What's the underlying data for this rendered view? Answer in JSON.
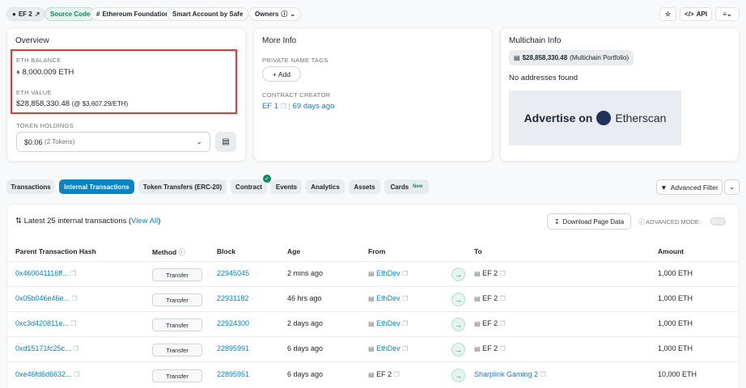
{
  "header": {
    "tag_ef2": "EF 2",
    "tag_source": "Source Code",
    "tag_foundation": "Ethereum Foundation",
    "tag_safe": "Smart Account by Safe",
    "tag_owners": "Owners",
    "api_label": "API"
  },
  "overview": {
    "title": "Overview",
    "eth_balance_label": "ETH BALANCE",
    "eth_balance": "8,000.009 ETH",
    "eth_value_label": "ETH VALUE",
    "eth_value": "$28,858,330.48",
    "eth_value_rate": "(@ $3,607.29/ETH)",
    "token_label": "TOKEN HOLDINGS",
    "token_value": "$0.06",
    "token_count": "(2 Tokens)"
  },
  "more_info": {
    "title": "More Info",
    "private_label": "PRIVATE NAME TAGS",
    "add_label": "+ Add",
    "creator_label": "CONTRACT CREATOR",
    "creator": "EF 1",
    "separator": "|",
    "creator_age": "69 days ago"
  },
  "multichain": {
    "title": "Multichain Info",
    "portfolio_value": "$28,858,330.48",
    "portfolio_suffix": "(Multichain Portfolio)",
    "no_addresses": "No addresses found",
    "ad_text": "Advertise on",
    "ad_brand": "Etherscan"
  },
  "tabs": [
    {
      "label": "Transactions"
    },
    {
      "label": "Internal Transactions"
    },
    {
      "label": "Token Transfers (ERC-20)"
    },
    {
      "label": "Contract"
    },
    {
      "label": "Events"
    },
    {
      "label": "Analytics"
    },
    {
      "label": "Assets"
    },
    {
      "label": "Cards"
    }
  ],
  "cards_badge": "New",
  "advanced_filter": "Advanced Filter",
  "table": {
    "summary": "Latest 25 internal transactions (",
    "view_all": "View All",
    "summary_end": ")",
    "download": "Download Page Data",
    "advanced_mode": "ADVANCED MODE:",
    "headers": {
      "hash": "Parent Transaction Hash",
      "method": "Method",
      "block": "Block",
      "age": "Age",
      "from": "From",
      "to": "To",
      "amount": "Amount"
    },
    "rows": [
      {
        "hash": "0x460041116ff...",
        "method": "Transfer",
        "block": "22945045",
        "age": "2 mins ago",
        "from": "EthDev",
        "to": "EF 2",
        "amount": "1,000 ETH"
      },
      {
        "hash": "0x05b046e46e...",
        "method": "Transfer",
        "block": "22931182",
        "age": "46 hrs ago",
        "from": "EthDev",
        "to": "EF 2",
        "amount": "1,000 ETH"
      },
      {
        "hash": "0xc3d420811e...",
        "method": "Transfer",
        "block": "22924300",
        "age": "2 days ago",
        "from": "EthDev",
        "to": "EF 2",
        "amount": "1,000 ETH"
      },
      {
        "hash": "0xd15171fc25c...",
        "method": "Transfer",
        "block": "22895991",
        "age": "6 days ago",
        "from": "EthDev",
        "to": "EF 2",
        "amount": "1,000 ETH"
      },
      {
        "hash": "0xe46fd6d6632...",
        "method": "Transfer",
        "block": "22895951",
        "age": "6 days ago",
        "from": "EF 2",
        "to": "Sharplink Gaming 2",
        "amount": "10,000 ETH"
      }
    ]
  },
  "colors": {
    "accent": "#0784c3",
    "success": "#0a8a5f",
    "highlight": "#e53935"
  }
}
